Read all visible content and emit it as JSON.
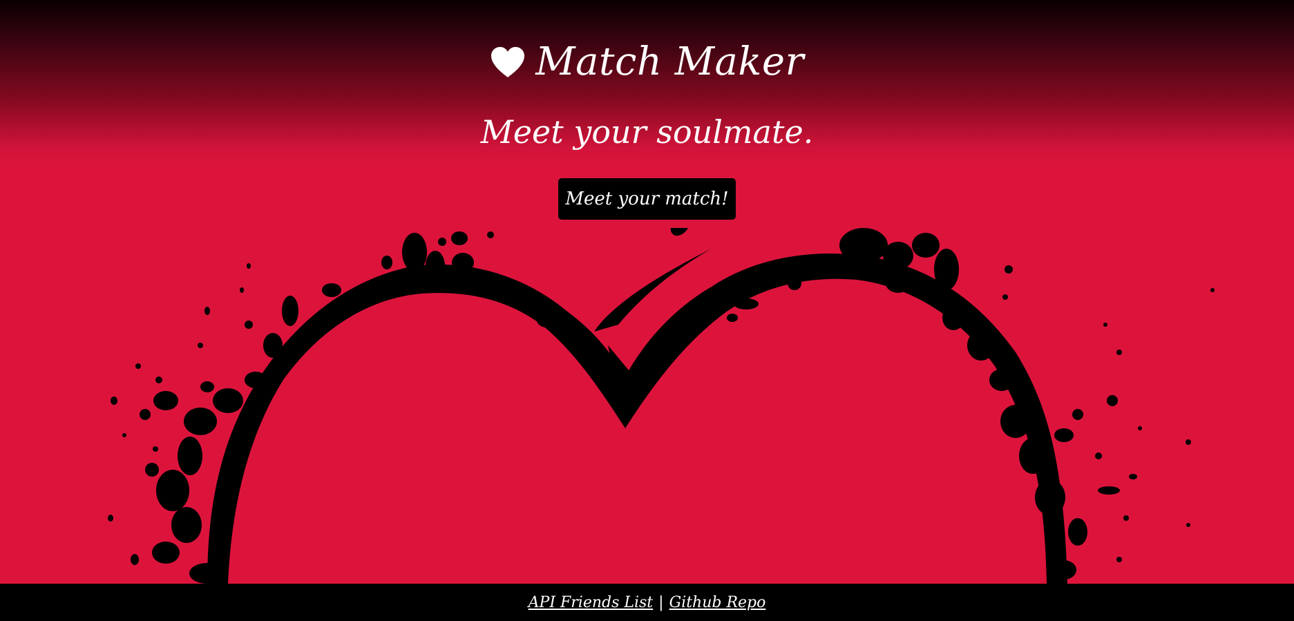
{
  "header": {
    "title": "Match Maker",
    "icon": "heart-icon",
    "tagline": "Meet your soulmate."
  },
  "cta": {
    "label": "Meet your match!"
  },
  "footer": {
    "links": [
      {
        "label": "API Friends List"
      },
      {
        "label": "Github Repo"
      }
    ],
    "separator": "|"
  },
  "colors": {
    "primary": "#dc143c",
    "dark": "#000000",
    "text": "#ffffff"
  }
}
